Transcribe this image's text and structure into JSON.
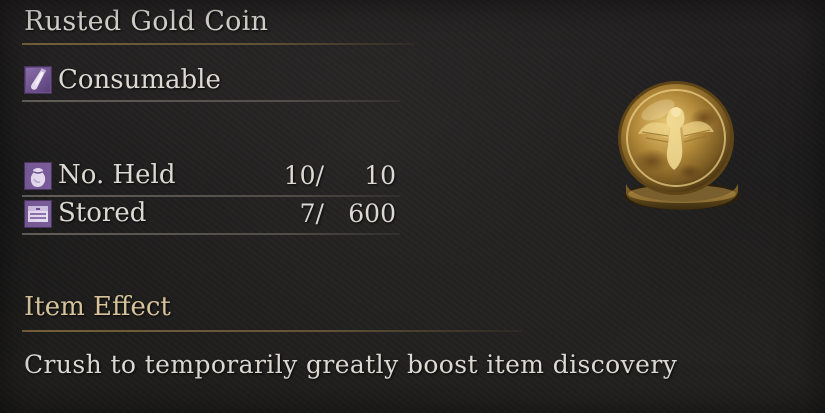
{
  "item": {
    "name": "Rusted Gold Coin",
    "category": "Consumable",
    "category_icon": "consumable-vial-icon",
    "image": "rusted-gold-coin-icon"
  },
  "stats": {
    "held": {
      "label": "No. Held",
      "icon": "pouch-icon",
      "current": "10/",
      "max": "10"
    },
    "stored": {
      "label": "Stored",
      "icon": "storage-box-icon",
      "current": "7/",
      "max": "600"
    }
  },
  "effect": {
    "heading": "Item Effect",
    "text": "Crush to temporarily greatly boost item discovery"
  },
  "colors": {
    "text": "#dcd9d3",
    "heading_gold": "#d6c39a",
    "icon_purple": "#8e6aa8"
  }
}
